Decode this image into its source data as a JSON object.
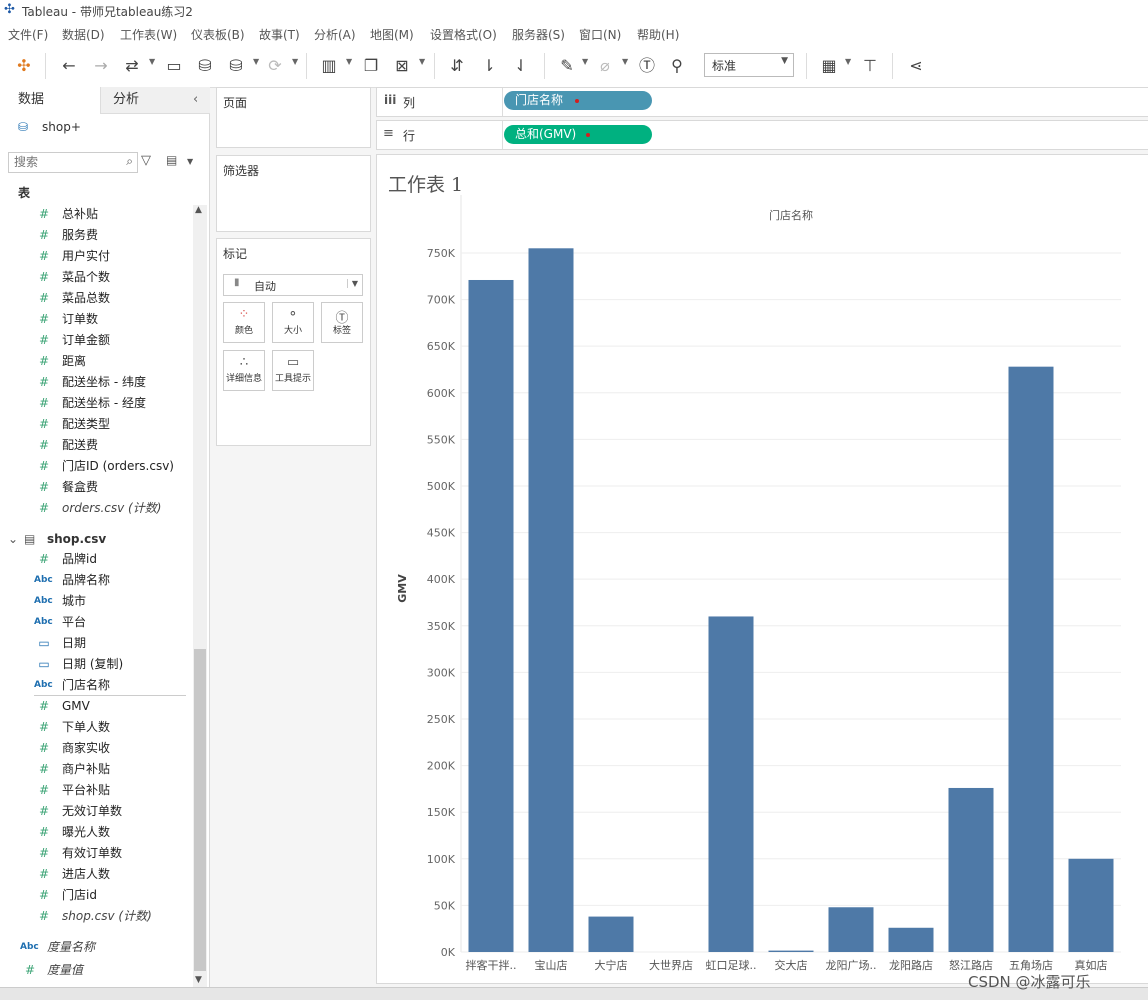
{
  "window": {
    "title": "Tableau - 带师兄tableau练习2"
  },
  "menu": [
    "文件(F)",
    "数据(D)",
    "工作表(W)",
    "仪表板(B)",
    "故事(T)",
    "分析(A)",
    "地图(M)",
    "设置格式(O)",
    "服务器(S)",
    "窗口(N)",
    "帮助(H)"
  ],
  "toolbar": {
    "fit_value": "标准"
  },
  "data_pane": {
    "tab_data": "数据",
    "tab_analysis": "分析",
    "datasource": "shop+",
    "search_placeholder": "搜索",
    "section_tables": "表",
    "orders_fields": [
      {
        "type": "measure",
        "label": "总补贴"
      },
      {
        "type": "measure",
        "label": "服务费"
      },
      {
        "type": "measure",
        "label": "用户实付"
      },
      {
        "type": "measure",
        "label": "菜品个数"
      },
      {
        "type": "measure",
        "label": "菜品总数"
      },
      {
        "type": "measure",
        "label": "订单数"
      },
      {
        "type": "measure",
        "label": "订单金额"
      },
      {
        "type": "measure",
        "label": "距离"
      },
      {
        "type": "measure",
        "label": "配送坐标 - 纬度"
      },
      {
        "type": "measure",
        "label": "配送坐标 - 经度"
      },
      {
        "type": "measure",
        "label": "配送类型"
      },
      {
        "type": "measure",
        "label": "配送费"
      },
      {
        "type": "measure",
        "label": "门店ID (orders.csv)"
      },
      {
        "type": "measure",
        "label": "餐盒费"
      },
      {
        "type": "measure",
        "label": "orders.csv (计数)",
        "italic": true
      }
    ],
    "shop_table": "shop.csv",
    "shop_fields": [
      {
        "type": "measure",
        "label": "品牌id"
      },
      {
        "type": "string",
        "label": "品牌名称"
      },
      {
        "type": "string",
        "label": "城市"
      },
      {
        "type": "string",
        "label": "平台"
      },
      {
        "type": "date",
        "label": "日期"
      },
      {
        "type": "date",
        "label": "日期 (复制)"
      },
      {
        "type": "string",
        "label": "门店名称"
      },
      {
        "type": "measure",
        "label": "GMV"
      },
      {
        "type": "measure",
        "label": "下单人数"
      },
      {
        "type": "measure",
        "label": "商家实收"
      },
      {
        "type": "measure",
        "label": "商户补贴"
      },
      {
        "type": "measure",
        "label": "平台补贴"
      },
      {
        "type": "measure",
        "label": "无效订单数"
      },
      {
        "type": "measure",
        "label": "曝光人数"
      },
      {
        "type": "measure",
        "label": "有效订单数"
      },
      {
        "type": "measure",
        "label": "进店人数"
      },
      {
        "type": "measure",
        "label": "门店id"
      },
      {
        "type": "measure",
        "label": "shop.csv (计数)",
        "italic": true
      }
    ],
    "bottom_fields": [
      {
        "type": "string",
        "label": "度量名称",
        "italic": true
      },
      {
        "type": "measure",
        "label": "度量值",
        "italic": true
      }
    ]
  },
  "shelves": {
    "pages": "页面",
    "filters": "筛选器",
    "marks": "标记",
    "mark_type": "自动",
    "mark_buttons": [
      "颜色",
      "大小",
      "标签",
      "详细信息",
      "工具提示"
    ],
    "columns_label": "列",
    "rows_label": "行",
    "columns_pill": "门店名称",
    "rows_pill": "总和(GMV)"
  },
  "colors": {
    "bar": "#4e79a7",
    "dim_pill": "#4996b2",
    "measure_pill": "#00b180"
  },
  "worksheet_title": "工作表 1",
  "chart_data": {
    "type": "bar",
    "header": "门店名称",
    "ylabel": "GMV",
    "ylim": [
      0,
      780000
    ],
    "grid": true,
    "yticks": [
      0,
      50000,
      100000,
      150000,
      200000,
      250000,
      300000,
      350000,
      400000,
      450000,
      500000,
      550000,
      600000,
      650000,
      700000,
      750000
    ],
    "ytick_labels": [
      "0K",
      "50K",
      "100K",
      "150K",
      "200K",
      "250K",
      "300K",
      "350K",
      "400K",
      "450K",
      "500K",
      "550K",
      "600K",
      "650K",
      "700K",
      "750K"
    ],
    "categories": [
      "拌客干拌..",
      "宝山店",
      "大宁店",
      "大世界店",
      "虹口足球..",
      "交大店",
      "龙阳广场..",
      "龙阳路店",
      "怒江路店",
      "五角场店",
      "真如店"
    ],
    "values": [
      721000,
      755000,
      38000,
      0,
      360000,
      1500,
      48000,
      26000,
      176000,
      628000,
      100000
    ]
  },
  "watermark": "CSDN @冰露可乐"
}
